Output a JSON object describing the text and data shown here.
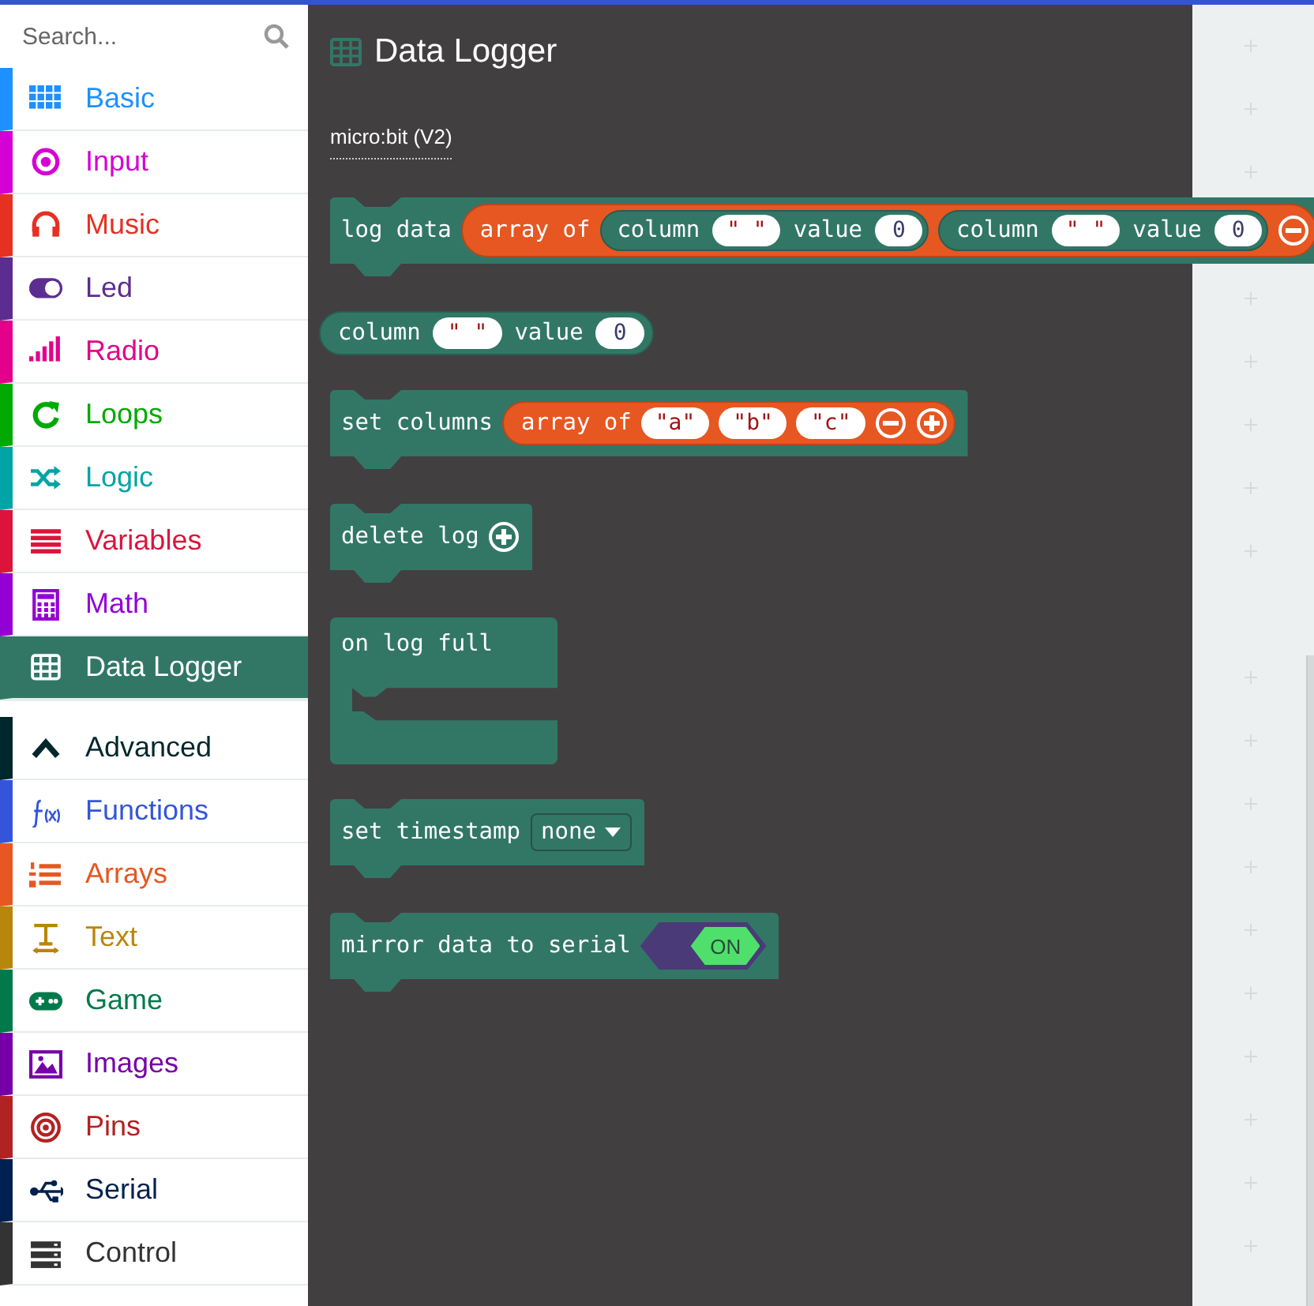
{
  "search": {
    "placeholder": "Search..."
  },
  "categories": [
    {
      "label": "Basic",
      "color": "#1e90ff",
      "selected": false
    },
    {
      "label": "Input",
      "color": "#d400d4",
      "selected": false
    },
    {
      "label": "Music",
      "color": "#e63022",
      "selected": false
    },
    {
      "label": "Led",
      "color": "#5c2d91",
      "selected": false
    },
    {
      "label": "Radio",
      "color": "#e3008c",
      "selected": false
    },
    {
      "label": "Loops",
      "color": "#00aa00",
      "selected": false
    },
    {
      "label": "Logic",
      "color": "#00a4a6",
      "selected": false
    },
    {
      "label": "Variables",
      "color": "#dc143c",
      "selected": false
    },
    {
      "label": "Math",
      "color": "#9400d3",
      "selected": false
    },
    {
      "label": "Data Logger",
      "color": "#327766",
      "selected": true
    }
  ],
  "advanced": {
    "label": "Advanced",
    "expanded": true,
    "color": "#00272b"
  },
  "advanced_categories": [
    {
      "label": "Functions",
      "color": "#3455db",
      "selected": false
    },
    {
      "label": "Arrays",
      "color": "#e65722",
      "selected": false
    },
    {
      "label": "Text",
      "color": "#b8860b",
      "selected": false
    },
    {
      "label": "Game",
      "color": "#007a4b",
      "selected": false
    },
    {
      "label": "Images",
      "color": "#7600a8",
      "selected": false
    },
    {
      "label": "Pins",
      "color": "#b22222",
      "selected": false
    },
    {
      "label": "Serial",
      "color": "#002050",
      "selected": false
    },
    {
      "label": "Control",
      "color": "#333333",
      "selected": false
    }
  ],
  "flyout": {
    "title": "Data Logger",
    "section": "micro:bit (V2)",
    "blocks": [
      {
        "kind": "statement",
        "parts": [
          {
            "kind": "text",
            "text": "log data"
          },
          {
            "kind": "array",
            "parts": [
              {
                "kind": "text",
                "text": "array of"
              },
              {
                "kind": "pill",
                "parts": [
                  {
                    "kind": "text",
                    "text": "column"
                  },
                  {
                    "kind": "string",
                    "text": "\" \""
                  },
                  {
                    "kind": "text",
                    "text": "value"
                  },
                  {
                    "kind": "number",
                    "text": "0"
                  }
                ]
              },
              {
                "kind": "pill",
                "parts": [
                  {
                    "kind": "text",
                    "text": "column"
                  },
                  {
                    "kind": "string",
                    "text": "\" \""
                  },
                  {
                    "kind": "text",
                    "text": "value"
                  },
                  {
                    "kind": "number",
                    "text": "0"
                  }
                ]
              },
              {
                "kind": "remove"
              }
            ]
          }
        ]
      },
      {
        "kind": "reporter",
        "parts": [
          {
            "kind": "text",
            "text": "column"
          },
          {
            "kind": "string",
            "text": "\" \""
          },
          {
            "kind": "text",
            "text": "value"
          },
          {
            "kind": "number",
            "text": "0"
          }
        ]
      },
      {
        "kind": "statement",
        "parts": [
          {
            "kind": "text",
            "text": "set columns"
          },
          {
            "kind": "array",
            "parts": [
              {
                "kind": "text",
                "text": "array of"
              },
              {
                "kind": "string",
                "text": "\"a\""
              },
              {
                "kind": "string",
                "text": "\"b\""
              },
              {
                "kind": "string",
                "text": "\"c\""
              },
              {
                "kind": "remove"
              },
              {
                "kind": "add"
              }
            ]
          }
        ]
      },
      {
        "kind": "statement",
        "parts": [
          {
            "kind": "text",
            "text": "delete log"
          },
          {
            "kind": "add"
          }
        ]
      },
      {
        "kind": "event",
        "parts": [
          {
            "kind": "text",
            "text": "on log full"
          }
        ]
      },
      {
        "kind": "statement",
        "parts": [
          {
            "kind": "text",
            "text": "set timestamp"
          },
          {
            "kind": "dropdown",
            "text": "none"
          }
        ]
      },
      {
        "kind": "statement",
        "parts": [
          {
            "kind": "text",
            "text": "mirror data to serial"
          },
          {
            "kind": "toggle",
            "text": "ON",
            "on": true
          }
        ]
      }
    ]
  }
}
